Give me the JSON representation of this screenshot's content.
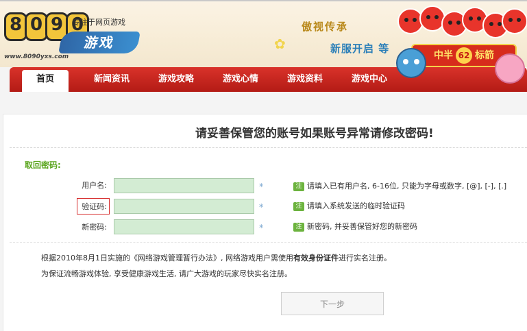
{
  "header": {
    "logo_digits": [
      "8",
      "0",
      "9",
      "0"
    ],
    "tagline": "专注于网页游戏",
    "brand_text": "游戏",
    "url_text": "www.8090yxs.com",
    "slogan_top": "傲视传承",
    "slogan_bottom": "新服开启 等",
    "badge_left": "中半",
    "badge_num": "62",
    "badge_right": "标箭"
  },
  "nav": {
    "items": [
      {
        "label": "首页"
      },
      {
        "label": "新闻资讯"
      },
      {
        "label": "游戏攻略"
      },
      {
        "label": "游戏心情"
      },
      {
        "label": "游戏资料"
      },
      {
        "label": "游戏中心"
      }
    ]
  },
  "page": {
    "title": "请妥善保管您的账号如果账号异常请修改密码!",
    "section_title": "取回密码:"
  },
  "form": {
    "username_label": "用户名:",
    "code_label": "验证码:",
    "password_label": "新密码:",
    "star": "*",
    "hint_tag": "注",
    "username_hint": "请填入已有用户名, 6-16位, 只能为字母或数字, [@], [-], [.]",
    "code_hint": "请填入系统发送的临时验证码",
    "password_hint": "新密码, 并妥善保管好您的新密码"
  },
  "notice": {
    "line1_pre": "根据2010年8月1日实施的《网络游戏管理暂行办法》, 网络游戏用户需使用",
    "line1_bold": "有效身份证件",
    "line1_post": "进行实名注册。",
    "line2": "为保证流畅游戏体验, 享受健康游戏生活, 请广大游戏的玩家尽快实名注册。"
  },
  "buttons": {
    "next": "下一步"
  }
}
